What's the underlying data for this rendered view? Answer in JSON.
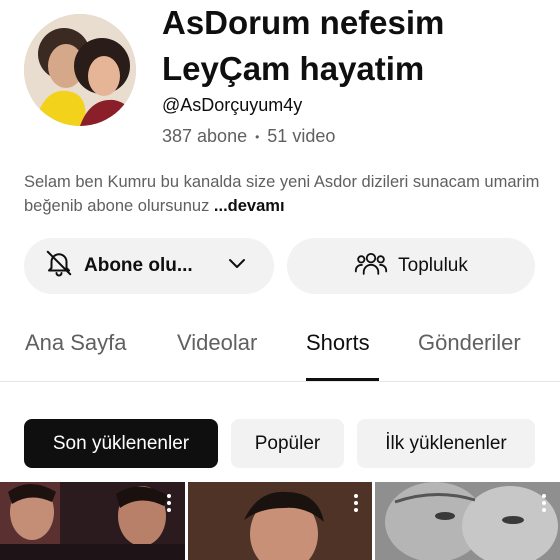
{
  "channel": {
    "title_line1": "AsDorum nefesim",
    "title_line2": "LeyÇam hayatim",
    "handle": "@AsDorçuyum4y",
    "subscribers": "387 abone",
    "separator": "•",
    "videos": "51 video",
    "description": "Selam ben Kumru bu kanalda size yeni Asdor dizileri sunacam umarim beğenib abone olursunuz",
    "description_more": "...devamı"
  },
  "actions": {
    "subscribe_label": "Abone olu...",
    "community_label": "Topluluk"
  },
  "tabs": [
    {
      "label": "Ana Sayfa",
      "active": false
    },
    {
      "label": "Videolar",
      "active": false
    },
    {
      "label": "Shorts",
      "active": true
    },
    {
      "label": "Gönderiler",
      "active": false
    }
  ],
  "filters": [
    {
      "label": "Son yüklenenler",
      "active": true
    },
    {
      "label": "Popüler",
      "active": false
    },
    {
      "label": "İlk yüklenenler",
      "active": false
    }
  ],
  "icons": {
    "bell": "bell-icon",
    "chevron": "chevron-down-icon",
    "community": "community-icon",
    "kebab": "more-vert-icon"
  },
  "colors": {
    "text_primary": "#0f0f0f",
    "text_secondary": "#606060",
    "chip_bg": "#f2f2f2",
    "chip_active_bg": "#0f0f0f"
  }
}
